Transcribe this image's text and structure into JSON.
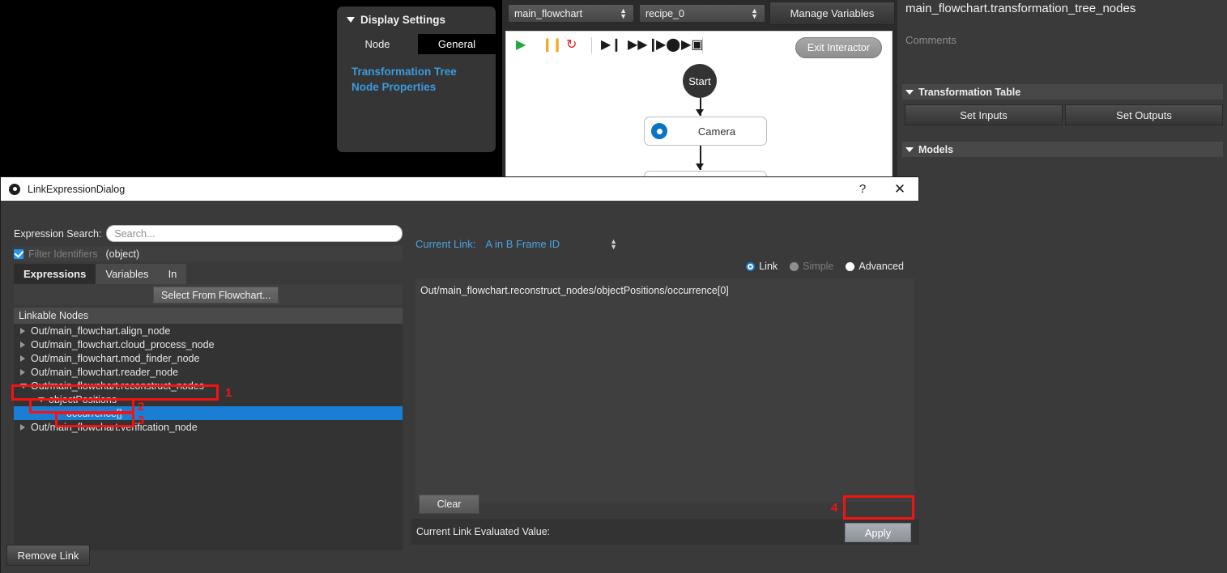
{
  "app": {
    "title": "main_flowchart.transformation_tree_nodes",
    "comments_placeholder": "Comments"
  },
  "display_settings": {
    "header": "Display Settings",
    "tabs": [
      {
        "label": "Node",
        "active": false
      },
      {
        "label": "General",
        "active": true
      }
    ],
    "links": [
      "Transformation Tree",
      "Node Properties"
    ]
  },
  "toolbar": {
    "flowchart_select": "main_flowchart",
    "recipe_select": "recipe_0",
    "manage_variables": "Manage Variables"
  },
  "flowchart": {
    "exit_button": "Exit Interactor",
    "icons": [
      "play-icon",
      "pause-icon",
      "reload-icon",
      "step-icon",
      "fast-forward-icon",
      "run-to-icon",
      "run-breakpoint-icon"
    ],
    "nodes": [
      {
        "label": "Start",
        "type": "start"
      },
      {
        "label": "Camera",
        "type": "box"
      },
      {
        "label": "",
        "type": "box"
      }
    ]
  },
  "right_panel": {
    "sections": [
      {
        "title": "Transformation Table"
      },
      {
        "title": "Models"
      }
    ],
    "buttons": [
      "Set Inputs",
      "Set Outputs"
    ]
  },
  "dialog": {
    "title": "LinkExpressionDialog",
    "help_glyph": "?",
    "close_glyph": "✕",
    "search": {
      "label": "Expression Search:",
      "placeholder": "Search...",
      "value": ""
    },
    "filter": {
      "checked": true,
      "label": "Filter Identifiers",
      "type_text": "(object)"
    },
    "tabs": [
      {
        "label": "Expressions",
        "active": true
      },
      {
        "label": "Variables",
        "active": false
      },
      {
        "label": "In",
        "active": false
      }
    ],
    "select_from_flowchart": "Select From Flowchart...",
    "linkable_nodes_header": "Linkable Nodes",
    "tree": [
      {
        "label": "Out/main_flowchart.align_node",
        "indent": 0,
        "state": "collapsed",
        "selected": false
      },
      {
        "label": "Out/main_flowchart.cloud_process_node",
        "indent": 0,
        "state": "collapsed",
        "selected": false
      },
      {
        "label": "Out/main_flowchart.mod_finder_node",
        "indent": 0,
        "state": "collapsed",
        "selected": false
      },
      {
        "label": "Out/main_flowchart.reader_node",
        "indent": 0,
        "state": "collapsed",
        "selected": false
      },
      {
        "label": "Out/main_flowchart.reconstruct_nodes",
        "indent": 0,
        "state": "expanded",
        "selected": false
      },
      {
        "label": "objectPositions",
        "indent": 1,
        "state": "expanded",
        "selected": false
      },
      {
        "label": "occurrence[]",
        "indent": 2,
        "state": "leaf",
        "selected": true
      },
      {
        "label": "Out/main_flowchart.verification_node",
        "indent": 0,
        "state": "collapsed",
        "selected": false
      }
    ],
    "remove_link": "Remove Link",
    "current_link": {
      "label": "Current Link:",
      "value": "A in B Frame ID"
    },
    "modes": [
      {
        "label": "Link",
        "selected": true,
        "enabled": true
      },
      {
        "label": "Simple",
        "selected": false,
        "enabled": false
      },
      {
        "label": "Advanced",
        "selected": false,
        "enabled": true
      }
    ],
    "expression": "Out/main_flowchart.reconstruct_nodes/objectPositions/occurrence[0]",
    "clear_button": "Clear",
    "evaluated_value_label": "Current Link Evaluated Value:",
    "apply_button": "Apply"
  },
  "annotations": [
    {
      "number": "1"
    },
    {
      "number": "2"
    },
    {
      "number": "3"
    },
    {
      "number": "4"
    }
  ],
  "colors": {
    "accent_blue": "#4aa3e0",
    "selection_blue": "#1a7fd4",
    "annotation_red": "#f41313",
    "panel_bg": "#3a3a3a",
    "tree_bg": "#333333"
  }
}
